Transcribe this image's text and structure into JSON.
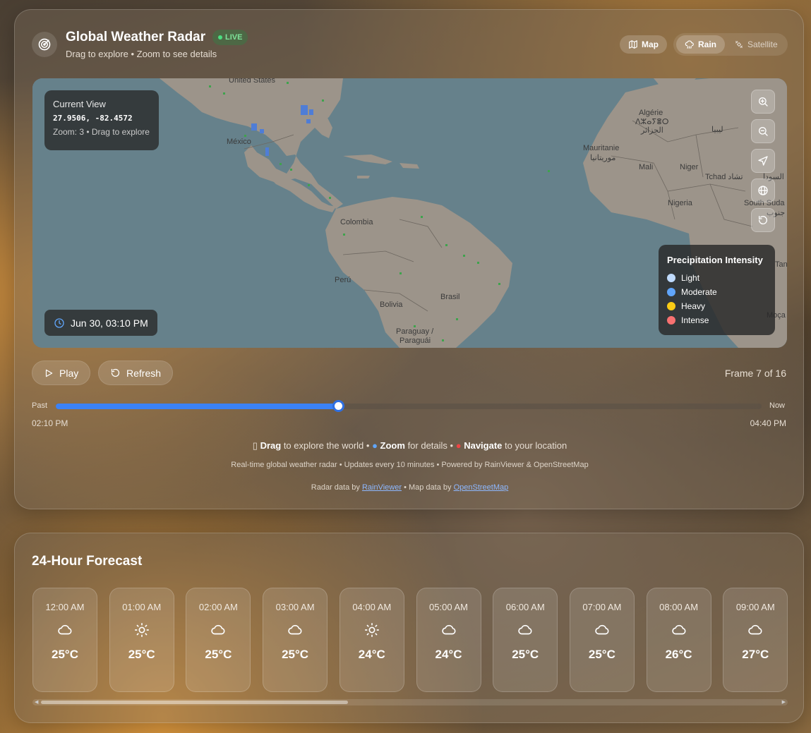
{
  "header": {
    "title": "Global Weather Radar",
    "live_label": "LIVE",
    "subtitle": "Drag to explore • Zoom to see details",
    "map_button": "Map",
    "rain_button": "Rain",
    "satellite_button": "Satellite"
  },
  "map": {
    "info_title": "Current View",
    "coords": "27.9506, -82.4572",
    "zoom_text": "Zoom: 3 • Drag to explore",
    "timestamp": "Jun 30, 03:10 PM",
    "labels": {
      "united_states": "United States",
      "mexico": "México",
      "colombia": "Colombia",
      "peru": "Perú",
      "bolivia": "Bolivia",
      "brasil": "Brasil",
      "paraguay": "Paraguay /",
      "paraguai": "Paraguái",
      "algerie": "Algérie",
      "algerie_tifinagh": "ⴷⵣⴰⵢⴻⵔ",
      "algerie_arabic": "الجزائر",
      "libya": "ليبيا",
      "mauritanie": "Mauritanie",
      "mauritanie_arabic": "موريتانيا",
      "mali": "Mali",
      "niger": "Niger",
      "tchad": "Tchad تشاد",
      "sudan": "السودا",
      "nigeria": "Nigeria",
      "south_sudan": "South Suda",
      "south_sudan_arabic": "جنوب",
      "tanzania": "Tan",
      "mocambique": "Moça"
    },
    "legend": {
      "title": "Precipitation Intensity",
      "items": [
        {
          "label": "Light",
          "color": "#bfdbfe"
        },
        {
          "label": "Moderate",
          "color": "#60a5fa"
        },
        {
          "label": "Heavy",
          "color": "#facc15"
        },
        {
          "label": "Intense",
          "color": "#f87171"
        }
      ]
    }
  },
  "controls": {
    "play_label": "Play",
    "refresh_label": "Refresh",
    "frame_text": "Frame 7 of 16",
    "frame_progress": 0.4,
    "past_label": "Past",
    "now_label": "Now",
    "start_time": "02:10 PM",
    "end_time": "04:40 PM"
  },
  "hint": {
    "drag_bold": "Drag",
    "drag_rest": "to explore the world •",
    "zoom_bold": "Zoom",
    "zoom_rest": "for details •",
    "nav_bold": "Navigate",
    "nav_rest": "to your location"
  },
  "footnote": "Real-time global weather radar • Updates every 10 minutes • Powered by RainViewer & OpenStreetMap",
  "credits": {
    "radar_prefix": "Radar data by",
    "radar_link": "RainViewer",
    "map_prefix": "• Map data by",
    "map_link": "OpenStreetMap"
  },
  "forecast": {
    "title": "24-Hour Forecast",
    "hours": [
      {
        "time": "12:00 AM",
        "icon": "cloud-icon",
        "temp": "25°C"
      },
      {
        "time": "01:00 AM",
        "icon": "sun-icon",
        "temp": "25°C"
      },
      {
        "time": "02:00 AM",
        "icon": "cloud-icon",
        "temp": "25°C"
      },
      {
        "time": "03:00 AM",
        "icon": "cloud-icon",
        "temp": "25°C"
      },
      {
        "time": "04:00 AM",
        "icon": "sun-icon",
        "temp": "24°C"
      },
      {
        "time": "05:00 AM",
        "icon": "cloud-icon",
        "temp": "24°C"
      },
      {
        "time": "06:00 AM",
        "icon": "cloud-icon",
        "temp": "25°C"
      },
      {
        "time": "07:00 AM",
        "icon": "cloud-icon",
        "temp": "25°C"
      },
      {
        "time": "08:00 AM",
        "icon": "cloud-icon",
        "temp": "26°C"
      },
      {
        "time": "09:00 AM",
        "icon": "cloud-icon",
        "temp": "27°C"
      }
    ]
  }
}
